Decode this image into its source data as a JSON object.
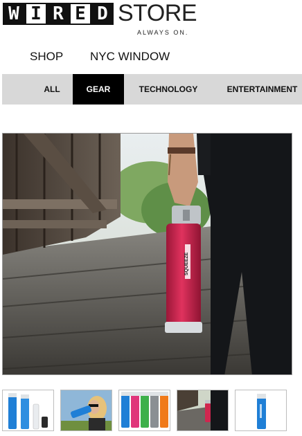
{
  "brand": {
    "logo_letters": [
      "W",
      "I",
      "R",
      "E",
      "D"
    ],
    "store_word": "STORE",
    "tagline": "ALWAYS ON."
  },
  "top_nav": {
    "items": [
      {
        "label": "SHOP"
      },
      {
        "label": "NYC WINDOW"
      }
    ]
  },
  "categories": {
    "items": [
      {
        "label": "ALL",
        "active": false
      },
      {
        "label": "GEAR",
        "active": true
      },
      {
        "label": "TECHNOLOGY",
        "active": false
      },
      {
        "label": "ENTERTAINMENT",
        "active": false
      }
    ]
  },
  "product": {
    "bottle_brand_text": "SQUEEZE",
    "bottle_color": "#d0264f"
  },
  "thumbnails": [
    {
      "name": "blue-bottle-set"
    },
    {
      "name": "woman-drinking"
    },
    {
      "name": "color-lineup"
    },
    {
      "name": "pink-bottle-lifestyle"
    },
    {
      "name": "blue-bottle-single"
    }
  ],
  "colors": {
    "category_bar": "#d8d8d8",
    "active_category": "#000000",
    "thumb_blue": "#1f7fd6",
    "thumb_pink": "#e0357a",
    "thumb_green": "#3db04a",
    "thumb_gray": "#8a8f93",
    "thumb_orange": "#f07a1a"
  }
}
